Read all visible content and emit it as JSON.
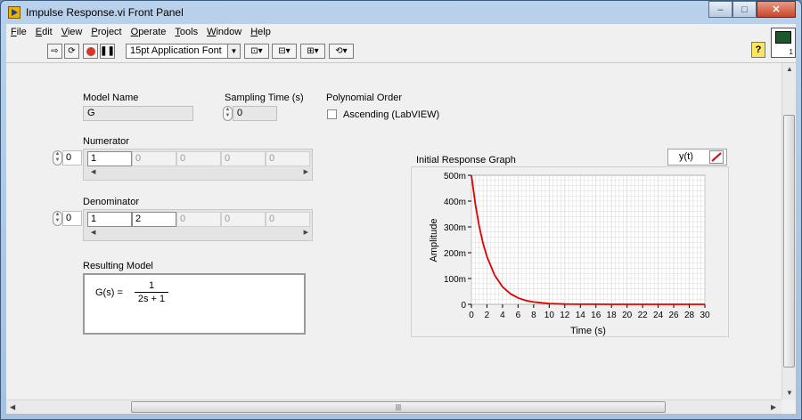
{
  "window": {
    "title": "Impulse Response.vi Front Panel",
    "min_glyph": "–",
    "max_glyph": "□",
    "close_glyph": "✕"
  },
  "menu": [
    {
      "label": "File",
      "key": "F",
      "rest": "ile"
    },
    {
      "label": "Edit",
      "key": "E",
      "rest": "dit"
    },
    {
      "label": "View",
      "key": "V",
      "rest": "iew"
    },
    {
      "label": "Project",
      "key": "P",
      "rest": "roject"
    },
    {
      "label": "Operate",
      "key": "O",
      "rest": "perate"
    },
    {
      "label": "Tools",
      "key": "T",
      "rest": "ools"
    },
    {
      "label": "Window",
      "key": "W",
      "rest": "indow"
    },
    {
      "label": "Help",
      "key": "H",
      "rest": "elp"
    }
  ],
  "toolbar": {
    "font": "15pt Application Font",
    "help": "?",
    "vi_icon_number": "1"
  },
  "controls": {
    "model_name_label": "Model Name",
    "model_name_value": "G",
    "sampling_time_label": "Sampling Time (s)",
    "sampling_time_value": "0",
    "polynomial_order_label": "Polynomial Order",
    "ascending_label": "Ascending (LabVIEW)",
    "ascending_checked": false,
    "numerator_label": "Numerator",
    "numerator_index": "0",
    "numerator_values": [
      "1",
      "0",
      "0",
      "0",
      "0"
    ],
    "denominator_label": "Denominator",
    "denominator_index": "0",
    "denominator_values": [
      "1",
      "2",
      "0",
      "0",
      "0"
    ],
    "resulting_model_label": "Resulting Model",
    "model_lhs": "G(s) =",
    "model_num": "1",
    "model_den": "2s + 1"
  },
  "chart_data": {
    "type": "line",
    "title": "Initial Response Graph",
    "xlabel": "Time (s)",
    "ylabel": "Amplitude",
    "xlim": [
      0,
      30
    ],
    "ylim": [
      0,
      0.5
    ],
    "x_ticks": [
      "0",
      "2",
      "4",
      "6",
      "8",
      "10",
      "12",
      "14",
      "16",
      "18",
      "20",
      "22",
      "24",
      "26",
      "28",
      "30"
    ],
    "y_ticks": [
      "0",
      "100m",
      "200m",
      "300m",
      "400m",
      "500m"
    ],
    "grid": true,
    "legend": "top-right",
    "series": [
      {
        "name": "y(t)",
        "color": "#e00000",
        "x": [
          0,
          0.5,
          1,
          1.5,
          2,
          3,
          4,
          5,
          6,
          7,
          8,
          9,
          10,
          12,
          14,
          16,
          18,
          20,
          22,
          24,
          26,
          28,
          30
        ],
        "values": [
          0.5,
          0.389,
          0.303,
          0.236,
          0.184,
          0.112,
          0.068,
          0.041,
          0.025,
          0.015,
          0.009,
          0.006,
          0.003,
          0.001,
          0.0005,
          0.0002,
          0.0001,
          0,
          0,
          0,
          0,
          0,
          0
        ]
      }
    ]
  }
}
